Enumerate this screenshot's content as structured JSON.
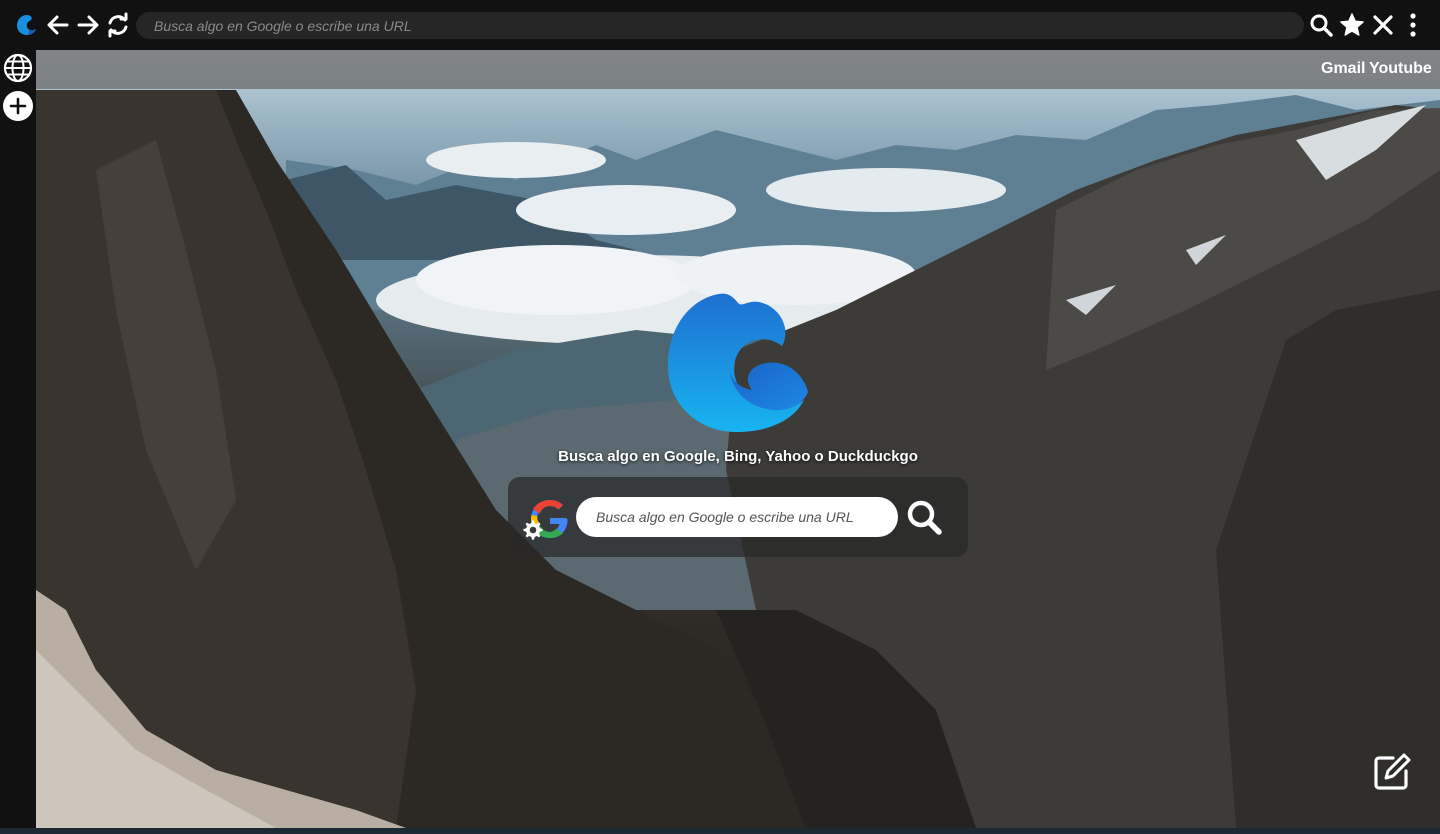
{
  "toolbar": {
    "url_placeholder": "Busca algo en Google o escribe una URL",
    "icons": [
      "browser-logo-icon",
      "back-arrow-icon",
      "forward-arrow-icon",
      "reload-icon",
      "search-icon",
      "bookmark-star-icon",
      "close-icon",
      "more-menu-icon"
    ]
  },
  "sidebar": {
    "icons": [
      "globe-icon",
      "add-tab-icon"
    ]
  },
  "shortcuts": [
    {
      "label": "Gmail"
    },
    {
      "label": "Youtube"
    }
  ],
  "main": {
    "tagline": "Busca algo en Google, Bing, Yahoo o Duckduckgo",
    "search_placeholder": "Busca algo en Google o escribe una URL",
    "engine_icon": "google-g-icon",
    "settings_icon": "gear-icon",
    "search_button_icon": "magnifier-icon",
    "edit_icon": "edit-pencil-icon"
  },
  "colors": {
    "toolbar_bg": "#111111",
    "urlbar_bg": "#262626",
    "logo_blue_light": "#1cb5f0",
    "logo_blue_dark": "#1a5fb4",
    "shortcuts_bar": "#6e6e6e"
  }
}
